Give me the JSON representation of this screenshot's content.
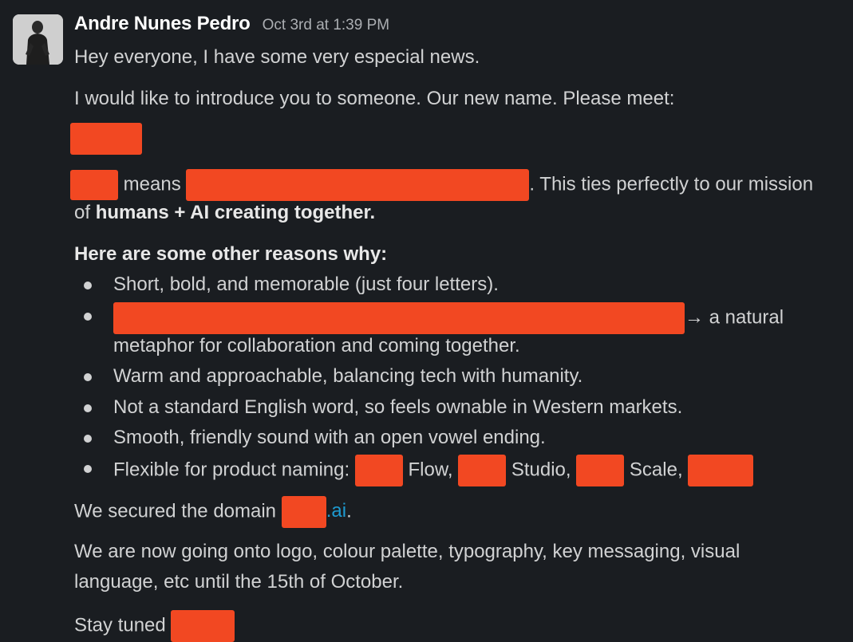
{
  "message": {
    "author": "Andre Nunes Pedro",
    "timestamp": "Oct 3rd at 1:39 PM",
    "line1": "Hey everyone, I have some very especial news.",
    "line2": "I would like to introduce you to someone. Our new name. Please meet:",
    "means_word": " means ",
    "means_tail": ". This ties perfectly to our mission",
    "mission_prefix": "of ",
    "mission_bold": "humans + AI creating together.",
    "reasons_heading": "Here are some other reasons why:",
    "bullets": {
      "b1": "Short, bold, and memorable (just four letters).",
      "b2_tail": "→ a natural",
      "b2_cont": "metaphor for collaboration and coming together.",
      "b3": "Warm and approachable, balancing tech with humanity.",
      "b4": "Not a standard English word, so feels ownable in Western markets.",
      "b5": "Smooth, friendly sound with an open vowel ending.",
      "b6_prefix": "Flexible for product naming: ",
      "b6_flow": " Flow, ",
      "b6_studio": " Studio, ",
      "b6_scale": " Scale, "
    },
    "domain_prefix": "We secured the domain ",
    "domain_link_suffix": ".ai",
    "domain_end": ".",
    "next_line1": "We are now going onto logo, colour palette, typography, key messaging, visual",
    "next_line2": "language, etc until the 15th of October.",
    "closing": "Stay tuned "
  },
  "colors": {
    "background": "#1a1d21",
    "text": "#d1d2d3",
    "author": "#ffffff",
    "timestamp": "#abaeb2",
    "link": "#1d9bd1",
    "redaction": "#f24822"
  }
}
